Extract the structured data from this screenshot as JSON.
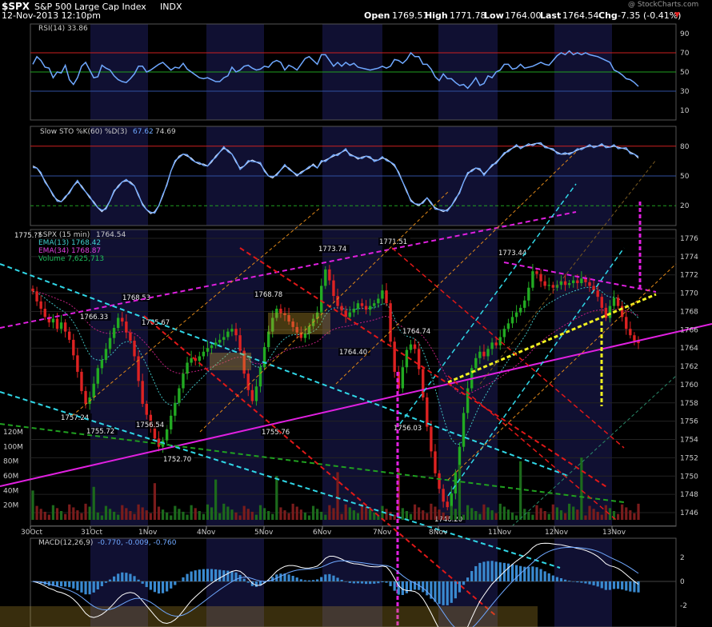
{
  "header": {
    "symbol": "$SPX",
    "name": "S&P 500 Large Cap Index",
    "exchange": "INDX",
    "datetime": "12-Nov-2013 12:10pm",
    "watermark": "@ StockCharts.com",
    "open_label": "Open",
    "open": "1769.51",
    "high_label": "High",
    "high": "1771.78",
    "low_label": "Low",
    "low": "1764.00",
    "last_label": "Last",
    "last": "1764.54",
    "chg_label": "Chg",
    "chg": "-7.35 (-0.41%)"
  },
  "legends": {
    "rsi": "RSI(14) 33.86",
    "sto_label": "Slow STO %K(60) %D(3)",
    "sto_k": "67.62",
    "sto_d": "74.69",
    "price_label": "$SPX (15 min)",
    "price_value": "1764.54",
    "ema13": "EMA(13) 1768.42",
    "ema34": "EMA(34) 1768.87",
    "volume": "Volume 7,625,713",
    "macd_label": "MACD(12,26,9)",
    "macd_values": "-0.770, -0.009, -0.760"
  },
  "colors": {
    "background": "#000000",
    "up_candle": "#22aa22",
    "down_candle": "#dd2222",
    "indicator_line": "#6fa8ff",
    "magenta_trend": "#e020e0",
    "cyan_channel": "#30d8e8",
    "yellow_trend": "#f0f020",
    "red_channel": "#e01818",
    "orange_channel": "#e08818",
    "green_trend": "#20a020"
  },
  "chart_data": [
    {
      "type": "line",
      "name": "RSI",
      "title": "RSI(14) 33.86",
      "y_ticks": [
        90,
        70,
        50,
        30,
        10
      ],
      "reference_lines": [
        70,
        50,
        30
      ],
      "ylim": [
        0,
        100
      ],
      "current": 33.86,
      "values": [
        58,
        66,
        62,
        55,
        54,
        44,
        50,
        49,
        57,
        42,
        37,
        44,
        56,
        60,
        52,
        44,
        45,
        57,
        54,
        52,
        46,
        42,
        40,
        39,
        43,
        48,
        56,
        56,
        50,
        52,
        55,
        58,
        60,
        56,
        52,
        55,
        54,
        59,
        53,
        50,
        47,
        44,
        43,
        44,
        42,
        40,
        40,
        44,
        46,
        55,
        50,
        52,
        56,
        57,
        54,
        52,
        53,
        56,
        55,
        60,
        62,
        60,
        52,
        57,
        55,
        52,
        58,
        64,
        66,
        62,
        58,
        68,
        68,
        62,
        56,
        60,
        56,
        60,
        57,
        59,
        55,
        54,
        53,
        52,
        53,
        54,
        56,
        54,
        56,
        63,
        62,
        59,
        63,
        70,
        66,
        66,
        58,
        58,
        53,
        45,
        41,
        48,
        43,
        43,
        39,
        36,
        37,
        33,
        38,
        44,
        36,
        38,
        46,
        44,
        50,
        52,
        58,
        58,
        53,
        54,
        58,
        54,
        55,
        56,
        58,
        60,
        58,
        57,
        62,
        67,
        70,
        68,
        72,
        68,
        70,
        68,
        70,
        68,
        67,
        66,
        64,
        62,
        60,
        52,
        50,
        47,
        43,
        42,
        39,
        35
      ]
    },
    {
      "type": "line",
      "name": "Slow STO",
      "title": "Slow STO %K(60) %D(3)",
      "y_ticks": [
        80,
        50,
        20
      ],
      "reference_lines": [
        80,
        50,
        20
      ],
      "ylim": [
        0,
        100
      ],
      "k_current": 67.62,
      "d_current": 74.69,
      "values_k": [
        60,
        58,
        52,
        45,
        38,
        30,
        26,
        24,
        28,
        34,
        40,
        44,
        40,
        34,
        28,
        24,
        18,
        14,
        18,
        25,
        34,
        40,
        44,
        45,
        44,
        40,
        30,
        22,
        16,
        12,
        14,
        20,
        30,
        42,
        55,
        64,
        70,
        72,
        70,
        68,
        64,
        62,
        62,
        60,
        64,
        70,
        74,
        78,
        76,
        72,
        64,
        58,
        60,
        64,
        66,
        64,
        62,
        56,
        50,
        48,
        52,
        56,
        60,
        58,
        54,
        50,
        54,
        56,
        58,
        62,
        58,
        64,
        66,
        68,
        70,
        72,
        74,
        76,
        72,
        70,
        67,
        69,
        70,
        68,
        66,
        66,
        68,
        67,
        64,
        60,
        54,
        44,
        34,
        26,
        22,
        20,
        24,
        28,
        22,
        18,
        16,
        14,
        16,
        20,
        26,
        34,
        44,
        52,
        56,
        58,
        56,
        52,
        56,
        60,
        64,
        68,
        72,
        76,
        78,
        80,
        79,
        80,
        81,
        82,
        83,
        82,
        80,
        78,
        76,
        74,
        72,
        72,
        73,
        74,
        76,
        78,
        79,
        80,
        80,
        80,
        81,
        80,
        79,
        80,
        79,
        78,
        77,
        74,
        72,
        68
      ]
    },
    {
      "type": "candlestick",
      "name": "$SPX (15 min)",
      "title": "$SPX (15 min) 1764.54",
      "x_ticks": [
        "30Oct",
        "31Oct",
        "1Nov",
        "4Nov",
        "5Nov",
        "6Nov",
        "7Nov",
        "8Nov",
        "11Nov",
        "12Nov",
        "13Nov"
      ],
      "y_ticks": [
        1776,
        1774,
        1772,
        1770,
        1768,
        1766,
        1764,
        1762,
        1760,
        1758,
        1756,
        1754,
        1752,
        1750,
        1748,
        1746
      ],
      "ylim": [
        1745,
        1777
      ],
      "last": 1764.54,
      "annotations": [
        "1775.??",
        "1768.53",
        "1766.33",
        "1765.67",
        "1757.24",
        "1755.72",
        "1756.54",
        "1752.70",
        "1755.76",
        "1768.78",
        "1773.74",
        "1764.40",
        "1771.51",
        "1764.74",
        "1756.03",
        "1746.20",
        "1773.44"
      ],
      "close": [
        1770.2,
        1769.1,
        1768.3,
        1767.4,
        1766.8,
        1767.2,
        1766.1,
        1766.8,
        1765.8,
        1764.9,
        1763.2,
        1761.4,
        1759.3,
        1757.9,
        1758.6,
        1760.1,
        1761.8,
        1762.7,
        1763.9,
        1765.1,
        1766.2,
        1767.3,
        1766.9,
        1765.7,
        1764.8,
        1763.1,
        1760.4,
        1757.9,
        1756.7,
        1755.4,
        1754.1,
        1753.2,
        1753.9,
        1755.1,
        1756.6,
        1758.0,
        1759.6,
        1761.2,
        1762.4,
        1762.9,
        1762.6,
        1763.1,
        1763.6,
        1764.0,
        1764.3,
        1764.6,
        1764.9,
        1765.2,
        1765.8,
        1766.1,
        1765.4,
        1763.7,
        1761.2,
        1759.4,
        1758.2,
        1759.8,
        1761.9,
        1764.1,
        1765.8,
        1767.3,
        1768.3,
        1767.8,
        1767.6,
        1766.9,
        1766.3,
        1765.7,
        1765.1,
        1765.6,
        1766.4,
        1767.2,
        1767.9,
        1770.8,
        1772.6,
        1771.4,
        1769.7,
        1768.6,
        1768.1,
        1767.4,
        1767.9,
        1768.3,
        1768.9,
        1768.6,
        1768.2,
        1768.6,
        1768.9,
        1769.4,
        1770.3,
        1768.9,
        1764.7,
        1761.4,
        1759.6,
        1761.9,
        1763.8,
        1764.4,
        1763.9,
        1761.7,
        1758.6,
        1755.4,
        1752.7,
        1750.3,
        1748.6,
        1747.2,
        1746.6,
        1748.1,
        1750.4,
        1753.2,
        1756.9,
        1759.6,
        1761.8,
        1762.9,
        1763.6,
        1763.1,
        1763.9,
        1764.6,
        1764.3,
        1765.2,
        1766.1,
        1766.7,
        1767.4,
        1767.9,
        1768.4,
        1769.2,
        1770.6,
        1772.4,
        1772.1,
        1771.3,
        1770.8,
        1770.9,
        1770.6,
        1770.9,
        1771.3,
        1770.9,
        1771.1,
        1771.4,
        1771.1,
        1771.6,
        1771.2,
        1770.8,
        1770.3,
        1769.6,
        1768.4,
        1767.3,
        1768.6,
        1769.5,
        1768.6,
        1767.4,
        1766.1,
        1765.4,
        1764.8,
        1764.54
      ]
    },
    {
      "type": "bar",
      "name": "Volume",
      "title": "Volume 7,625,713",
      "y_ticks": [
        "120M",
        "100M",
        "80M",
        "60M",
        "40M",
        "20M"
      ],
      "ylim": [
        0,
        130
      ],
      "unit": "M"
    },
    {
      "type": "line",
      "name": "MACD",
      "title": "MACD(12,26,9) -0.770, -0.009, -0.760",
      "y_ticks": [
        2,
        0,
        -2
      ],
      "ylim": [
        -3,
        3
      ],
      "macd": -0.77,
      "signal": -0.009,
      "histogram": -0.76
    }
  ]
}
